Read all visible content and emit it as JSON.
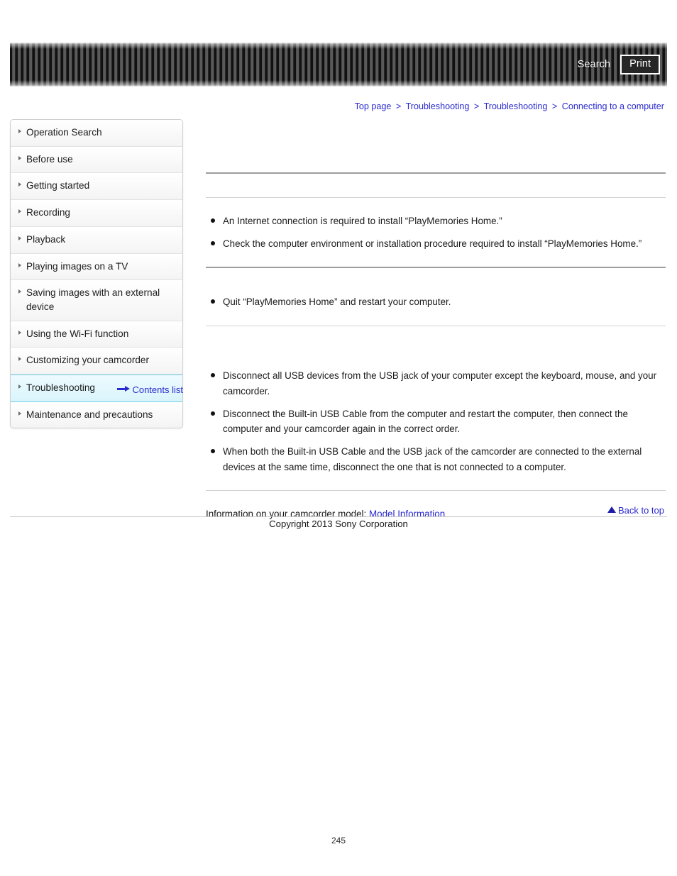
{
  "header": {
    "search_label": "Search",
    "print_label": "Print"
  },
  "breadcrumb": {
    "separator": ">",
    "items": [
      {
        "label": "Top page"
      },
      {
        "label": "Troubleshooting"
      },
      {
        "label": "Troubleshooting"
      },
      {
        "label": "Connecting to a computer"
      }
    ]
  },
  "sidebar": {
    "items": [
      {
        "label": "Operation Search",
        "active": false
      },
      {
        "label": "Before use",
        "active": false
      },
      {
        "label": "Getting started",
        "active": false
      },
      {
        "label": "Recording",
        "active": false
      },
      {
        "label": "Playback",
        "active": false
      },
      {
        "label": "Playing images on a TV",
        "active": false
      },
      {
        "label": "Saving images with an external device",
        "active": false
      },
      {
        "label": "Using the Wi-Fi function",
        "active": false
      },
      {
        "label": "Customizing your camcorder",
        "active": false
      },
      {
        "label": "Troubleshooting",
        "active": true
      },
      {
        "label": "Maintenance and precautions",
        "active": false
      }
    ],
    "contents_list_label": "Contents list"
  },
  "main": {
    "page_title": "",
    "sections": [
      {
        "title": "",
        "bullets": [
          "An Internet connection is required to install “PlayMemories Home.”",
          "Check the computer environment or installation procedure required to install “PlayMemories Home.”"
        ]
      },
      {
        "title": "",
        "bullets": [
          "Quit “PlayMemories Home” and restart your computer."
        ]
      },
      {
        "title": "",
        "bullets": [
          "Disconnect all USB devices from the USB jack of your computer except the keyboard, mouse, and your camcorder.",
          "Disconnect the Built-in USB Cable from the computer and restart the computer, then connect the computer and your camcorder again in the correct order.",
          "When both the Built-in USB Cable and the USB jack of the camcorder are connected to the external devices at the same time, disconnect the one that is not connected to a computer."
        ]
      }
    ],
    "model_info_prefix": "Information on your camcorder model:",
    "model_info_link": "Model Information"
  },
  "footer": {
    "back_to_top_label": "Back to top",
    "copyright": "Copyright 2013 Sony Corporation",
    "page_number": "245"
  }
}
